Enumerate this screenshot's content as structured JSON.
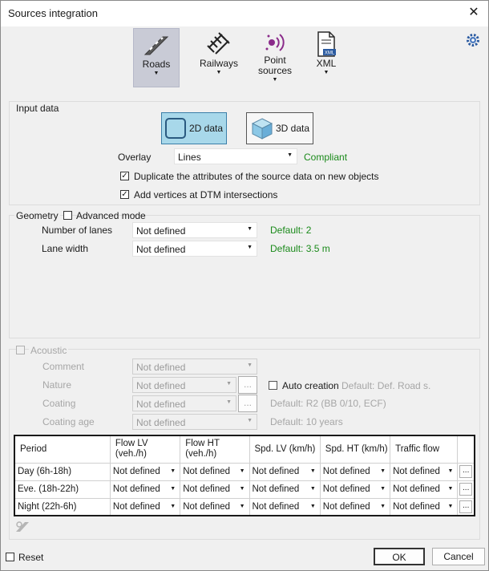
{
  "window": {
    "title": "Sources integration"
  },
  "ribbon": {
    "buttons": [
      {
        "label": "Roads",
        "selected": true
      },
      {
        "label": "Railways"
      },
      {
        "label": "Point",
        "label2": "sources"
      },
      {
        "label": "XML"
      }
    ]
  },
  "input_data": {
    "group_label": "Input data",
    "mode_2d": "2D data",
    "mode_3d": "3D data",
    "overlay_label": "Overlay",
    "overlay_value": "Lines",
    "overlay_status": "Compliant",
    "duplicate_label": "Duplicate the attributes of the source data on new objects",
    "vertices_label": "Add vertices at DTM intersections"
  },
  "geometry": {
    "group_label": "Geometry",
    "advanced_label": "Advanced mode",
    "lanes_label": "Number of lanes",
    "lanes_value": "Not defined",
    "lanes_default": "Default: 2",
    "width_label": "Lane width",
    "width_value": "Not defined",
    "width_default": "Default: 3.5 m"
  },
  "acoustic": {
    "group_label": "Acoustic",
    "comment_label": "Comment",
    "comment_value": "Not defined",
    "nature_label": "Nature",
    "nature_value": "Not defined",
    "auto_label": "Auto creation",
    "auto_default": "Default: Def. Road s.",
    "coating_label": "Coating",
    "coating_value": "Not defined",
    "coating_default": "Default: R2 (BB 0/10, ECF)",
    "age_label": "Coating age",
    "age_value": "Not defined",
    "age_default": "Default: 10 years",
    "more": "..."
  },
  "table": {
    "headers": [
      "Period",
      "Flow LV\n(veh./h)",
      "Flow HT\n(veh./h)",
      "Spd. LV (km/h)",
      "Spd. HT (km/h)",
      "Traffic flow"
    ],
    "rows": [
      {
        "period": "Day (6h-18h)",
        "cells": [
          "Not defined",
          "Not defined",
          "Not defined",
          "Not defined",
          "Not defined"
        ]
      },
      {
        "period": "Eve. (18h-22h)",
        "cells": [
          "Not defined",
          "Not defined",
          "Not defined",
          "Not defined",
          "Not defined"
        ]
      },
      {
        "period": "Night (22h-6h)",
        "cells": [
          "Not defined",
          "Not defined",
          "Not defined",
          "Not defined",
          "Not defined"
        ]
      }
    ],
    "more": "..."
  },
  "footer": {
    "reset_label": "Reset",
    "ok_label": "OK",
    "cancel_label": "Cancel"
  },
  "colors": {
    "selected_mode": "#a8d8ea",
    "ribbon_selected": "#c9cbd6",
    "default_text": "#1a8a1a"
  }
}
